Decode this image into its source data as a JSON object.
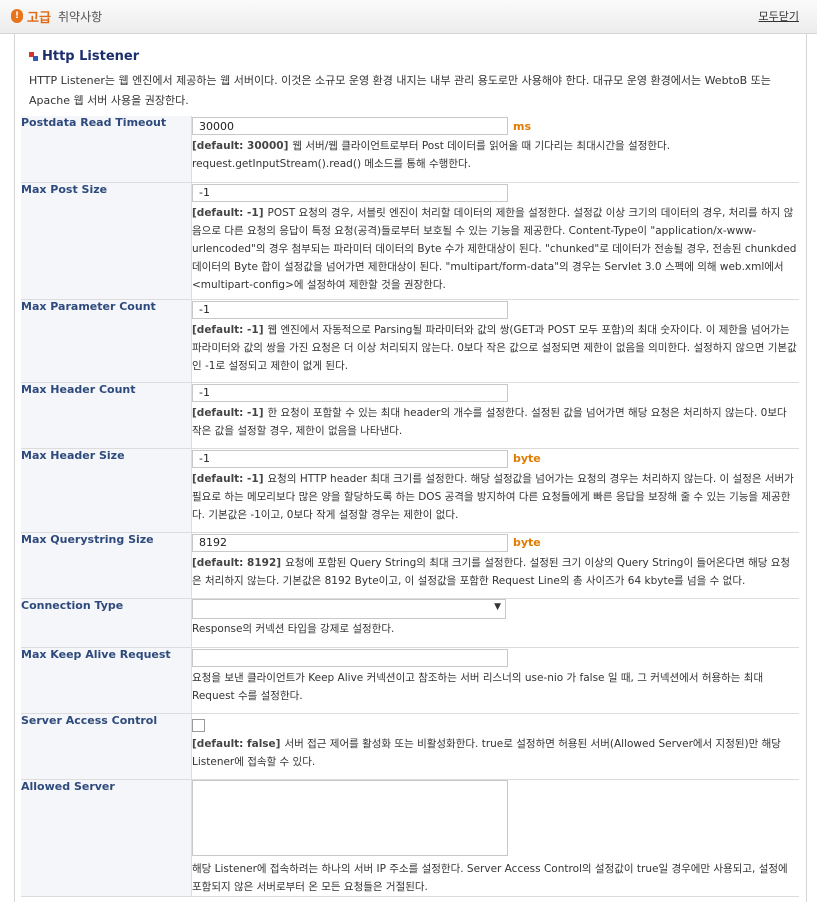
{
  "header": {
    "badge": "!",
    "title": "고급",
    "subtitle": "취약사항",
    "close_all": "모두닫기"
  },
  "section": {
    "title": "Http Listener",
    "description": "HTTP Listener는 웹 엔진에서 제공하는 웹 서버이다. 이것은 소규모 운영 환경 내지는 내부 관리 용도로만 사용해야 한다. 대규모 운영 환경에서는 WebtoB 또는 Apache 웹 서버 사용을 권장한다."
  },
  "fields": [
    {
      "label": "Postdata Read Timeout",
      "value": "30000",
      "unit": "ms",
      "default": "[default: 30000]",
      "desc": "웹 서버/웹 클라이언트로부터 Post 데이터를 읽어올 때 기다리는 최대시간을 설정한다. request.getInputStream().read() 메소드를 통해 수행한다."
    },
    {
      "label": "Max Post Size",
      "value": "-1",
      "unit": "",
      "default": "[default: -1]",
      "desc": "POST 요청의 경우, 서블릿 엔진이 처리할 데이터의 제한을 설정한다. 설정값 이상 크기의 데이터의 경우, 처리를 하지 않음으로 다른 요청의 응답이 특정 요청(공격)들로부터 보호될 수 있는 기능을 제공한다. Content-Type이 \"application/x-www-urlencoded\"의 경우 첨부되는 파라미터 데이터의 Byte 수가 제한대상이 된다. \"chunked\"로 데이터가 전송될 경우, 전송된 chunkded 데이터의 Byte 합이 설정값을 넘어가면 제한대상이 된다. \"multipart/form-data\"의 경우는 Servlet 3.0 스펙에 의해 web.xml에서 <multipart-config>에 설정하여 제한할 것을 권장한다."
    },
    {
      "label": "Max Parameter Count",
      "value": "-1",
      "unit": "",
      "default": "[default: -1]",
      "desc": "웹 엔진에서 자동적으로 Parsing될 파라미터와 값의 쌍(GET과 POST 모두 포함)의 최대 숫자이다. 이 제한을 넘어가는 파라미터와 값의 쌍을 가진 요청은 더 이상 처리되지 않는다. 0보다 작은 값으로 설정되면 제한이 없음을 의미한다. 설정하지 않으면 기본값인 -1로 설정되고 제한이 없게 된다."
    },
    {
      "label": "Max Header Count",
      "value": "-1",
      "unit": "",
      "default": "[default: -1]",
      "desc": "한 요청이 포함할 수 있는 최대 header의 개수를 설정한다. 설정된 값을 넘어가면 해당 요청은 처리하지 않는다. 0보다 작은 값을 설정할 경우, 제한이 없음을 나타낸다."
    },
    {
      "label": "Max Header Size",
      "value": "-1",
      "unit": "byte",
      "default": "[default: -1]",
      "desc": "요청의 HTTP header 최대 크기를 설정한다. 해당 설정값을 넘어가는 요청의 경우는 처리하지 않는다. 이 설정은 서버가 필요로 하는 메모리보다 많은 양을 할당하도록 하는 DOS 공격을 방지하여 다른 요청들에게 빠른 응답을 보장해 줄 수 있는 기능을 제공한다. 기본값은 -1이고, 0보다 작게 설정할 경우는 제한이 없다."
    },
    {
      "label": "Max Querystring Size",
      "value": "8192",
      "unit": "byte",
      "default": "[default: 8192]",
      "desc": "요청에 포함된 Query String의 최대 크기를 설정한다. 설정된 크기 이상의 Query String이 들어온다면 해당 요청은 처리하지 않는다. 기본값은 8192 Byte이고, 이 설정값을 포함한 Request Line의 총 사이즈가 64 kbyte를 넘을 수 없다."
    }
  ],
  "connection_type": {
    "label": "Connection Type",
    "selected": "",
    "arrow": "▼",
    "desc": "Response의 커넥션 타입을 강제로 설정한다."
  },
  "keep_alive": {
    "label": "Max Keep Alive Request",
    "value": "",
    "desc": "요청을 보낸 클라이언트가 Keep Alive 커넥션이고 참조하는 서버 리스너의 use-nio 가 false 일 때, 그 커넥션에서 허용하는 최대 Request 수를 설정한다."
  },
  "access_control": {
    "label": "Server Access Control",
    "checked": false,
    "default": "[default: false]",
    "desc": "서버 접근 제어를 활성화 또는 비활성화한다. true로 설정하면 허용된 서버(Allowed Server에서 지정된)만 해당 Listener에 접속할 수 있다."
  },
  "allowed_server": {
    "label": "Allowed Server",
    "value": "",
    "desc": "해당 Listener에 접속하려는 하나의 서버 IP 주소를 설정한다. Server Access Control의 설정값이 true일 경우에만 사용되고, 설정에 포함되지 않은 서버로부터 온 모든 요청들은 거절된다."
  },
  "colors": {
    "accent": "#e06a14",
    "label": "#2e4a7c",
    "unit": "#e07b00",
    "title": "#1c2d6e"
  },
  "icons": {
    "header": "warning-icon",
    "section": "section-icon",
    "select": "chevron-down-icon"
  }
}
